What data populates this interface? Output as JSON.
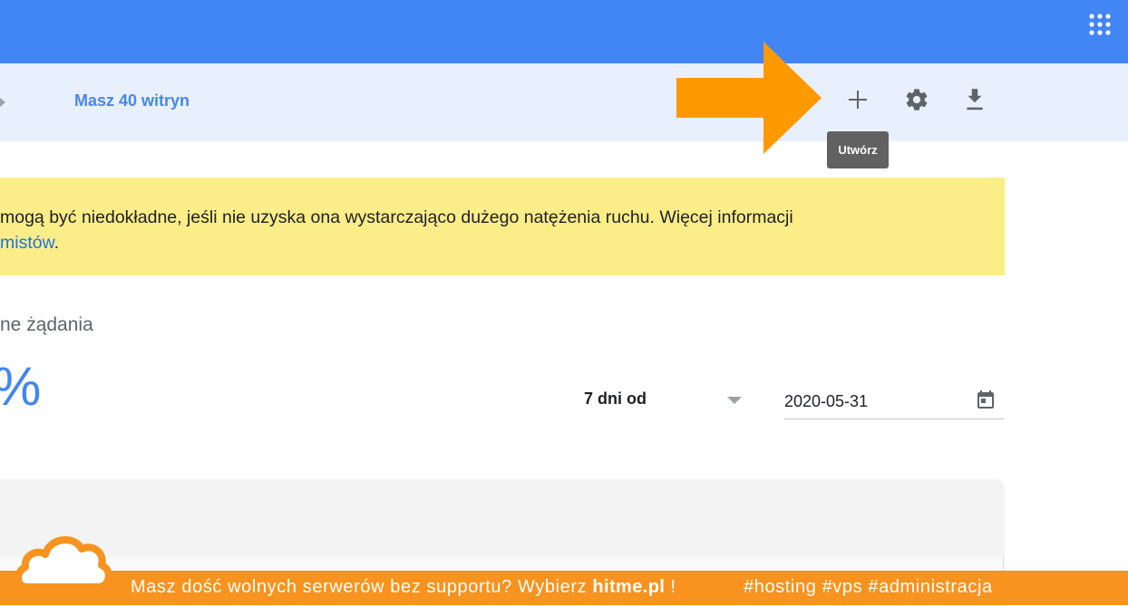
{
  "header": {
    "icons": {
      "apps": "apps-grid-icon"
    }
  },
  "subbar": {
    "sites_count": "Masz 40 witryn",
    "tooltip": "Utwórz",
    "icons": {
      "add": "plus-icon",
      "settings": "gear-icon",
      "download": "download-icon"
    }
  },
  "notice": {
    "line1": "mogą być niedokładne, jeśli nie uzyska ona wystarczająco dużego natężenia ruchu. Więcej informacji",
    "link": "mistów",
    "line2_suffix": "."
  },
  "stats": {
    "label": "ne żądania",
    "value": "%"
  },
  "filters": {
    "range_label": "7 dni od",
    "date_value": "2020-05-31"
  },
  "banner": {
    "text": "Masz dość wolnych serwerów bez supportu? Wybierz ",
    "brand": "hitme.pl",
    "text_end": " !",
    "tags": "#hosting #vps #administracja"
  },
  "colors": {
    "topbar": "#4285f4",
    "subbar": "#e8f0fe",
    "notice": "#fbed88",
    "arrow": "#ff9900",
    "banner": "#f7931e",
    "link": "#1a73e8"
  }
}
